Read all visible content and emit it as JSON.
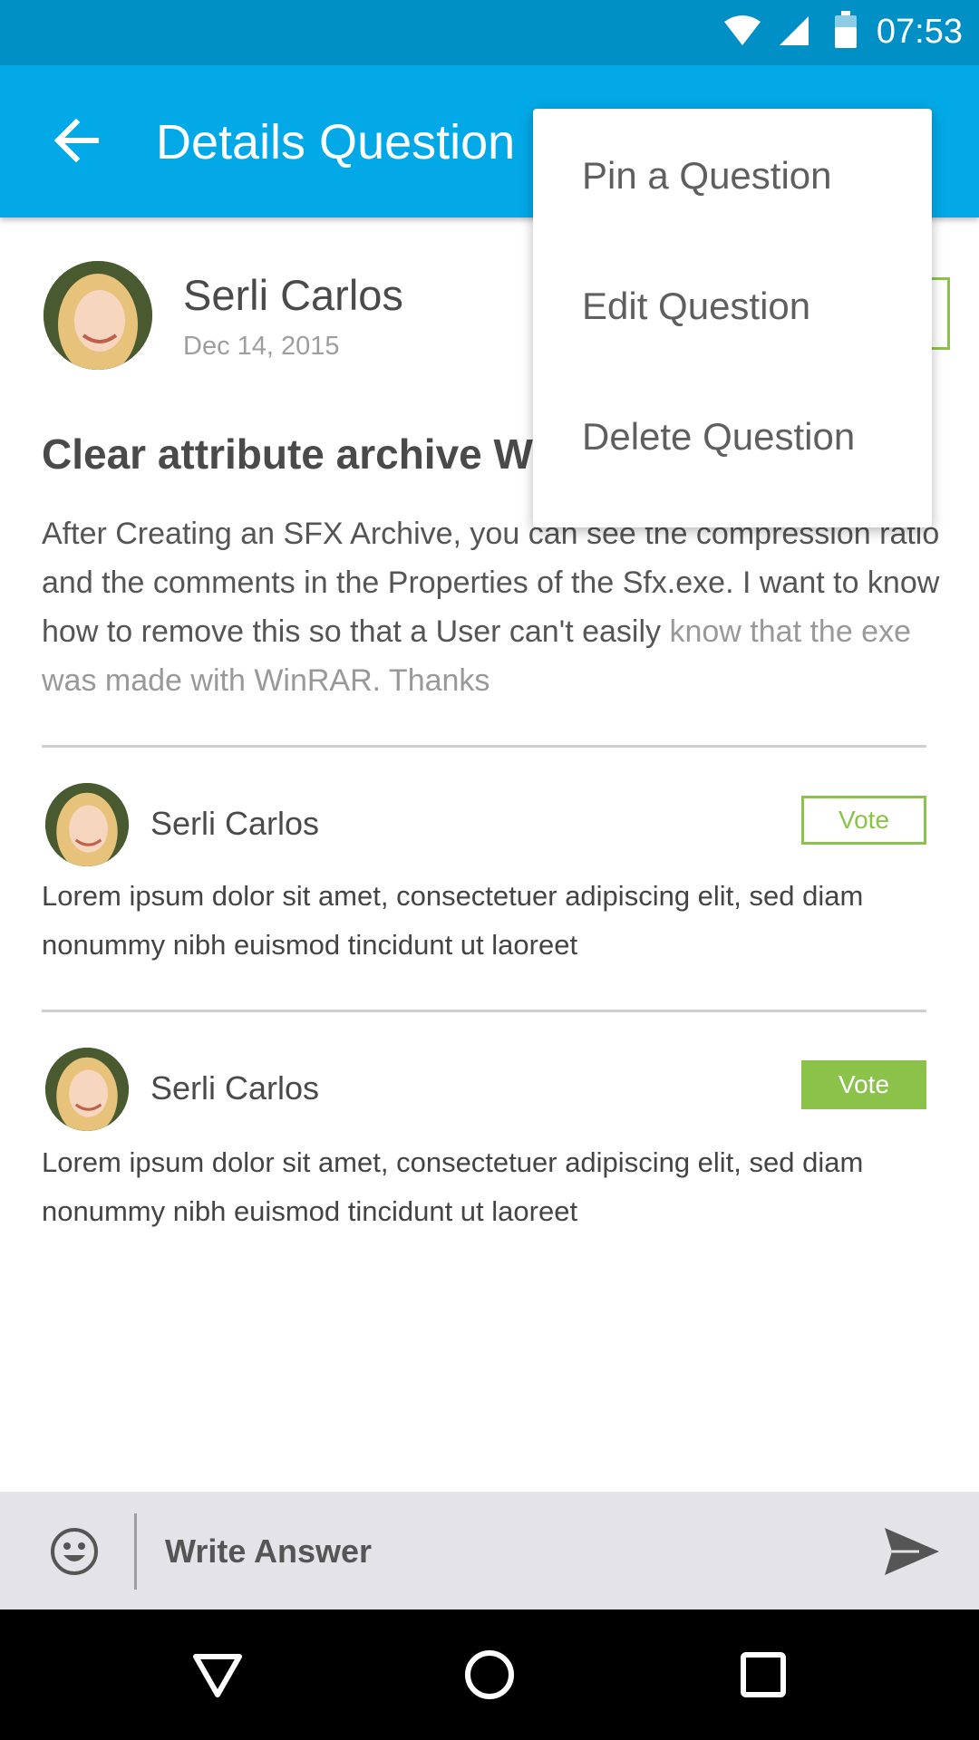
{
  "status_bar": {
    "time": "07:53",
    "icons": [
      "wifi-icon",
      "signal-icon",
      "battery-icon"
    ]
  },
  "app_bar": {
    "title": "Details Question",
    "back_icon": "arrow-left-icon",
    "color": "#03a9e7"
  },
  "question": {
    "author": "Serli Carlos",
    "date": "Dec 14, 2015",
    "title": "Clear attribute archive W",
    "body_main": "After Creating an SFX Archive, you can see the compression ratio and the comments in the Properties of the Sfx.exe. I want to know how to remove this so that a User can't easily",
    "body_fade": "know that the exe was made with WinRAR. Thanks"
  },
  "answers": [
    {
      "author": "Serli Carlos",
      "text": "Lorem ipsum dolor sit amet, consectetuer adipiscing elit, sed diam nonummy nibh euismod tincidunt ut laoreet",
      "vote_label": "Vote",
      "voted": false
    },
    {
      "author": "Serli Carlos",
      "text": "Lorem ipsum dolor sit amet, consectetuer adipiscing elit, sed diam nonummy nibh euismod tincidunt ut laoreet",
      "vote_label": "Vote",
      "voted": true
    }
  ],
  "menu": {
    "items": [
      {
        "label": "Pin a Question"
      },
      {
        "label": "Edit Question"
      },
      {
        "label": "Delete Question"
      }
    ]
  },
  "composer": {
    "placeholder": "Write Answer",
    "emoji_icon": "emoji-icon",
    "send_icon": "send-icon"
  },
  "nav_bar": {
    "icons": [
      "back-triangle-icon",
      "home-circle-icon",
      "recents-square-icon"
    ]
  },
  "colors": {
    "accent_green": "#8bc34a",
    "status_bar": "#0090c6"
  }
}
